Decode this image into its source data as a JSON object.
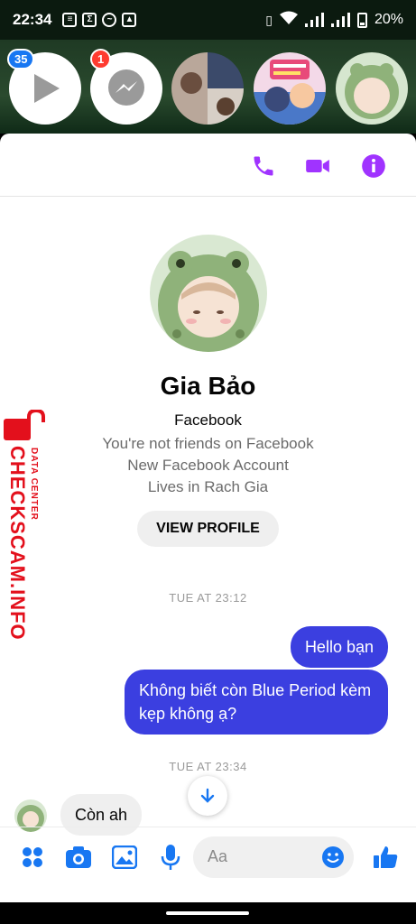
{
  "status_bar": {
    "time": "22:34",
    "battery": "20%",
    "notif_icons": [
      "notes-icon",
      "sigma-icon",
      "messenger-icon",
      "image-icon"
    ]
  },
  "chat_heads": {
    "first_badge": "35",
    "second_badge": "1"
  },
  "header_actions": [
    "phone-icon",
    "video-icon",
    "info-icon"
  ],
  "profile": {
    "name": "Gia Bảo",
    "platform": "Facebook",
    "friend_status": "You're not friends on Facebook",
    "account_note": "New Facebook Account",
    "location": "Lives in Rach Gia",
    "view_profile_label": "VIEW PROFILE"
  },
  "messages": [
    {
      "type": "timestamp",
      "text": "TUE AT 23:12"
    },
    {
      "type": "outgoing",
      "text": "Hello bạn"
    },
    {
      "type": "outgoing",
      "text": "Không biết còn Blue Period kèm kẹp không ạ?"
    },
    {
      "type": "timestamp",
      "text": "TUE AT 23:34"
    },
    {
      "type": "incoming",
      "text": "Còn ah"
    }
  ],
  "composer": {
    "placeholder": "Aa",
    "icons": [
      "apps-icon",
      "camera-icon",
      "gallery-icon",
      "microphone-icon",
      "emoji-icon",
      "thumbs-up-icon"
    ]
  },
  "watermark": {
    "main": "CHECKSCAM.INFO",
    "sub": "DATA CENTER"
  },
  "colors": {
    "accent_purple": "#a033ff",
    "bubble_outgoing": "#3b3fe0",
    "icon_blue": "#1877f2",
    "watermark_red": "#e3101c"
  }
}
